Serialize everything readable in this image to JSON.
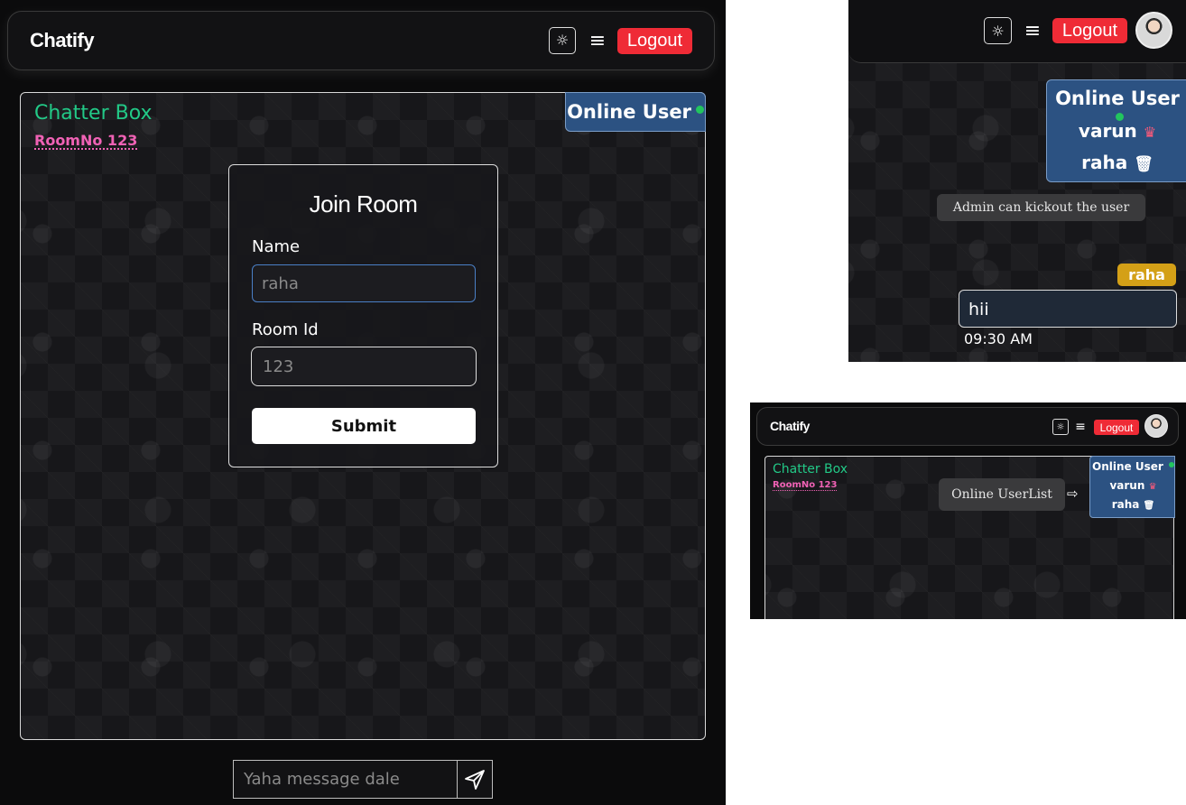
{
  "main": {
    "brand": "Chatify",
    "logout_label": "Logout",
    "chat_title": "Chatter Box",
    "room_label": "RoomNo 123",
    "online_title": "Online User",
    "form": {
      "title": "Join Room",
      "name_label": "Name",
      "name_placeholder": "raha",
      "room_label": "Room Id",
      "room_placeholder": "123",
      "submit_label": "Submit"
    },
    "message_placeholder": "Yaha message dale"
  },
  "inset_top": {
    "logout_label": "Logout",
    "online_title": "Online User",
    "users": [
      {
        "name": "varun",
        "icon": "crown-icon"
      },
      {
        "name": "raha",
        "icon": "trash-icon"
      }
    ],
    "tooltip": "Admin can kickout the user",
    "message": {
      "sender": "raha",
      "text": "hii",
      "time": "09:30 AM"
    }
  },
  "inset_bottom": {
    "brand": "Chatify",
    "logout_label": "Logout",
    "chat_title": "Chatter Box",
    "room_label": "RoomNo 123",
    "tooltip": "Online UserList",
    "online_title": "Online User",
    "users": [
      {
        "name": "varun",
        "icon": "crown-icon"
      },
      {
        "name": "raha",
        "icon": "trash-icon"
      }
    ]
  },
  "colors": {
    "background": "#0b0b0c",
    "accent_green": "#22c987",
    "room_pink": "#f062b5",
    "logout_red": "#ef2b36",
    "online_panel_blue": "#2c5282",
    "sender_badge": "#d4a017"
  }
}
